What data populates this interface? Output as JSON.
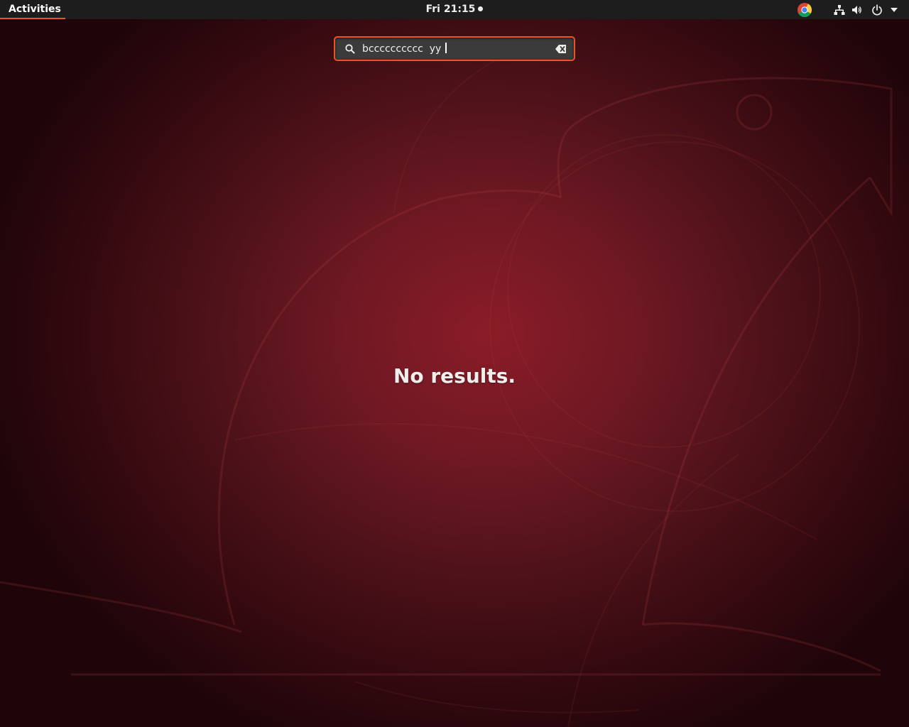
{
  "top_bar": {
    "activities_label": "Activities",
    "clock_text": "Fri 21:15",
    "tray_icons": [
      "chrome-icon",
      "network-icon",
      "volume-icon",
      "power-icon",
      "dropdown-arrow-icon"
    ]
  },
  "search": {
    "value": "bcccccccccc  yy ",
    "icon": "search-icon",
    "clear_icon": "clear-icon"
  },
  "results": {
    "message": "No results."
  },
  "colors": {
    "accent": "#e95420",
    "top_bar_bg": "#1d1d1d",
    "text": "#eeeeec"
  }
}
